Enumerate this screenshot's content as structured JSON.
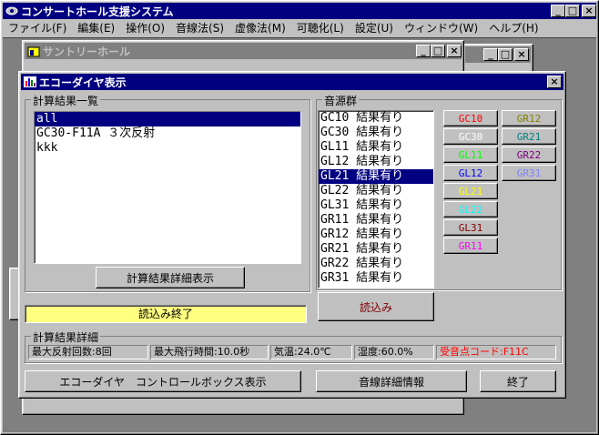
{
  "main_window": {
    "title": "コンサートホール支援システム",
    "menu": [
      "ファイル(F)",
      "編集(E)",
      "操作(O)",
      "音線法(S)",
      "虚像法(M)",
      "可聴化(L)",
      "設定(U)",
      "ウィンドウ(W)",
      "ヘルプ(H)"
    ]
  },
  "bg_window": {
    "title": "サントリーホール"
  },
  "dialog": {
    "title": "エコーダイヤ表示",
    "results_group_label": "計算結果一覧",
    "results_items": [
      "all",
      "GC30-F11A ３次反射",
      "kkk"
    ],
    "results_selected_index": 0,
    "detail_button": "計算結果詳細表示",
    "status_text": "読込み終了",
    "sources_group_label": "音源群",
    "sources_items": [
      "GC10 結果有り",
      "GC30 結果有り",
      "GL11 結果有り",
      "GL12 結果有り",
      "GL21 結果有り",
      "GL22 結果有り",
      "GL31 結果有り",
      "GR11 結果有り",
      "GR12 結果有り",
      "GR21 結果有り",
      "GR22 結果有り",
      "GR31 結果有り"
    ],
    "sources_selected_index": 4,
    "load_button": "読込み",
    "source_buttons_col1": [
      {
        "label": "GC10",
        "color": "#ff0000"
      },
      {
        "label": "GC30",
        "color": "#ffffff"
      },
      {
        "label": "GL11",
        "color": "#00ff00"
      },
      {
        "label": "GL12",
        "color": "#0000ff"
      },
      {
        "label": "GL21",
        "color": "#ffff00"
      },
      {
        "label": "GL22",
        "color": "#00ffff"
      },
      {
        "label": "GL31",
        "color": "#800000"
      },
      {
        "label": "GR11",
        "color": "#ff00ff"
      }
    ],
    "source_buttons_col2": [
      {
        "label": "GR12",
        "color": "#808000"
      },
      {
        "label": "GR21",
        "color": "#008080"
      },
      {
        "label": "GR22",
        "color": "#800080"
      },
      {
        "label": "GR31",
        "color": "#8080ff"
      }
    ],
    "detail_group_label": "計算結果詳細",
    "detail_fields": [
      {
        "text": "最大反射回数:8回",
        "color": "#000000"
      },
      {
        "text": "最大飛行時間:10.0秒",
        "color": "#000000"
      },
      {
        "text": "気温:24.0℃",
        "color": "#000000"
      },
      {
        "text": "湿度:60.0%",
        "color": "#000000"
      },
      {
        "text": "受音点コード:F11C",
        "color": "#ff0000"
      }
    ],
    "bottom_buttons": [
      "エコーダイヤ　コントロールボックス表示",
      "音線詳細情報",
      "終了"
    ]
  }
}
